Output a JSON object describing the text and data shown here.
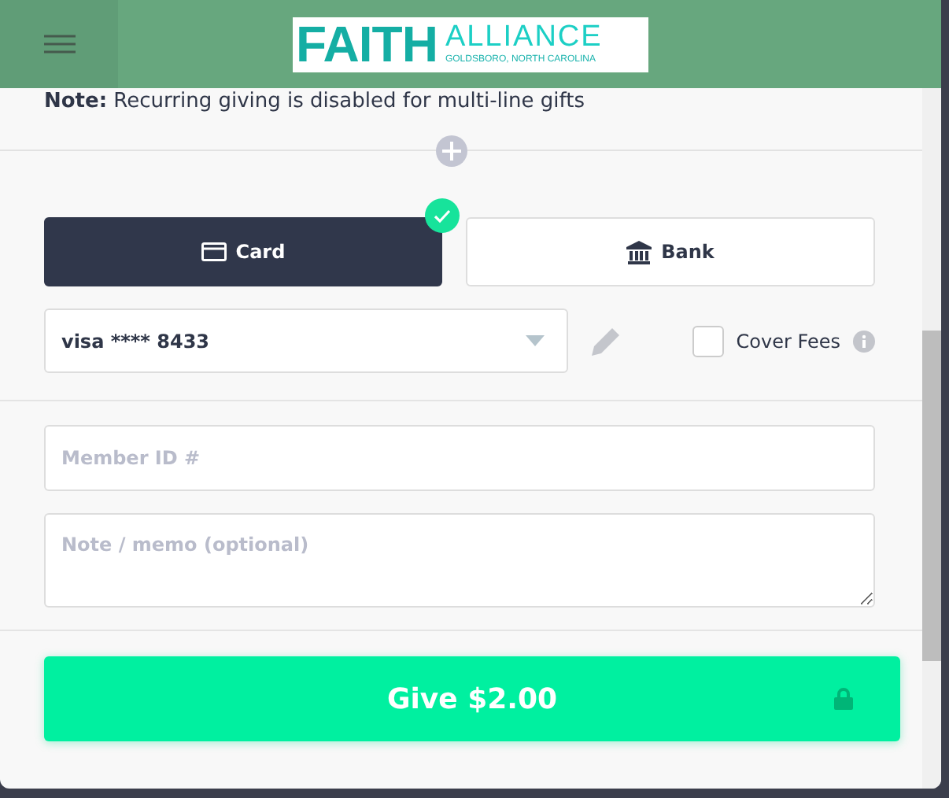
{
  "header": {
    "logo": {
      "name": "FAITH",
      "suffix": "ALLIANCE",
      "tagline": "GOLDSBORO, NORTH CAROLINA"
    }
  },
  "note": "**Note:** Recurring giving is disabled for multi-line gifts",
  "payment_tabs": [
    {
      "label": "Card",
      "kind": "card",
      "selected": true
    },
    {
      "label": "Bank",
      "kind": "bank",
      "selected": false
    }
  ],
  "payment_method": {
    "value": "visa **** 8433"
  },
  "cover_fees": {
    "label": "Cover Fees",
    "checked": false
  },
  "member_id": {
    "placeholder": "Member ID #"
  },
  "memo": {
    "placeholder": "Note / memo (optional)"
  },
  "give_button": {
    "label": "Give $2.00"
  }
}
